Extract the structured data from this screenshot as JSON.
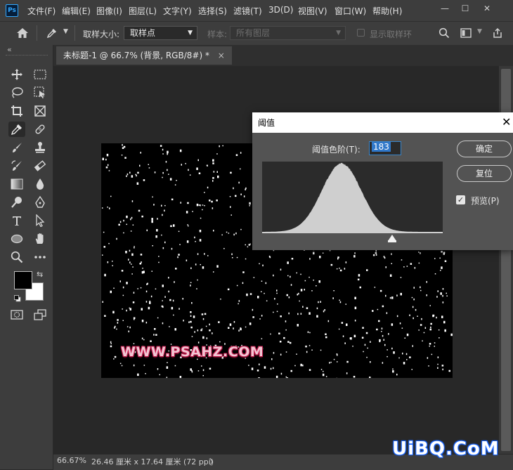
{
  "app": {
    "logo": "Ps"
  },
  "menu": [
    "文件(F)",
    "编辑(E)",
    "图像(I)",
    "图层(L)",
    "文字(Y)",
    "选择(S)",
    "滤镜(T)",
    "3D(D)",
    "视图(V)",
    "窗口(W)",
    "帮助(H)"
  ],
  "window_controls": {
    "minimize": "—",
    "maximize": "☐",
    "close": "✕"
  },
  "options_bar": {
    "sample_size_label": "取样大小:",
    "sample_size_value": "取样点",
    "sample_label": "样本:",
    "sample_value": "所有图层",
    "show_ring_label": "显示取样环"
  },
  "toolbar": {
    "collapse": "«"
  },
  "document": {
    "tab_title": "未标题-1 @ 66.7% (背景, RGB/8#) *",
    "tab_close": "×"
  },
  "canvas": {
    "watermark": "WWW.PSAHZ.COM",
    "background": "#000000",
    "speck_color": "#ffffff"
  },
  "status": {
    "zoom": "66.67%",
    "doc_size": "26.46 厘米 x 17.64 厘米 (72 ppi)",
    "arrow": "〉"
  },
  "dialog": {
    "title": "阈值",
    "close": "✕",
    "level_label": "阈值色阶(T):",
    "level_value": "183",
    "ok_label": "确定",
    "reset_label": "复位",
    "preview_label": "预览(P)",
    "preview_checked": true,
    "threshold_fraction": 0.718
  },
  "foreground_color": "#000000",
  "background_color": "#ffffff",
  "corner_logo": "UiBQ.CoM"
}
